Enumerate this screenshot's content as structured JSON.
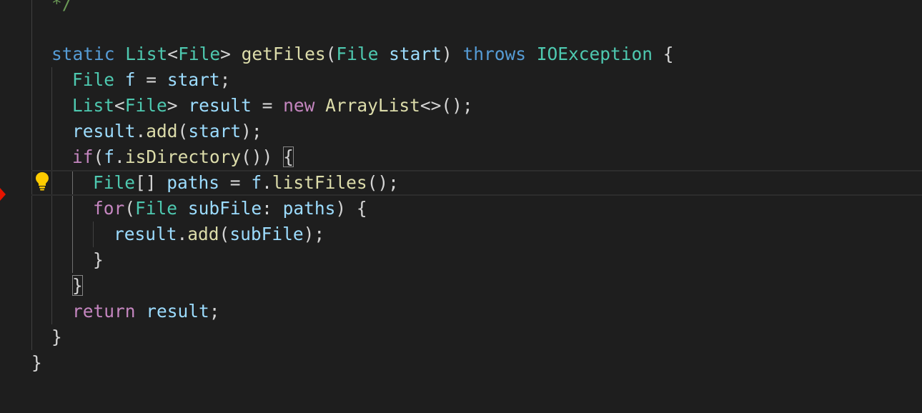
{
  "editor": {
    "language": "java",
    "lines": [
      {
        "id": "l0",
        "tokens": [
          {
            "t": "*/",
            "c": "cm"
          }
        ]
      },
      {
        "id": "l1",
        "tokens": []
      },
      {
        "id": "l2",
        "tokens": [
          {
            "t": "static",
            "c": "kw"
          },
          {
            "t": " "
          },
          {
            "t": "List",
            "c": "ty"
          },
          {
            "t": "<",
            "c": "pu"
          },
          {
            "t": "File",
            "c": "ty"
          },
          {
            "t": ">",
            "c": "pu"
          },
          {
            "t": " "
          },
          {
            "t": "getFiles",
            "c": "fn"
          },
          {
            "t": "(",
            "c": "pu"
          },
          {
            "t": "File",
            "c": "ty"
          },
          {
            "t": " "
          },
          {
            "t": "start",
            "c": "var"
          },
          {
            "t": ") ",
            "c": "pu"
          },
          {
            "t": "throws",
            "c": "kw"
          },
          {
            "t": " "
          },
          {
            "t": "IOException",
            "c": "ty"
          },
          {
            "t": " {",
            "c": "pu"
          }
        ]
      },
      {
        "id": "l3",
        "tokens": [
          {
            "t": "File",
            "c": "ty"
          },
          {
            "t": " "
          },
          {
            "t": "f",
            "c": "var"
          },
          {
            "t": " = ",
            "c": "pu"
          },
          {
            "t": "start",
            "c": "var"
          },
          {
            "t": ";",
            "c": "pu"
          }
        ]
      },
      {
        "id": "l4",
        "tokens": [
          {
            "t": "List",
            "c": "ty"
          },
          {
            "t": "<",
            "c": "pu"
          },
          {
            "t": "File",
            "c": "ty"
          },
          {
            "t": "> ",
            "c": "pu"
          },
          {
            "t": "result",
            "c": "var"
          },
          {
            "t": " = ",
            "c": "pu"
          },
          {
            "t": "new",
            "c": "ctl"
          },
          {
            "t": " "
          },
          {
            "t": "ArrayList",
            "c": "fn"
          },
          {
            "t": "<>();",
            "c": "pu"
          }
        ]
      },
      {
        "id": "l5",
        "tokens": [
          {
            "t": "result",
            "c": "var"
          },
          {
            "t": ".",
            "c": "pu"
          },
          {
            "t": "add",
            "c": "fn"
          },
          {
            "t": "(",
            "c": "pu"
          },
          {
            "t": "start",
            "c": "var"
          },
          {
            "t": ");",
            "c": "pu"
          }
        ]
      },
      {
        "id": "l6",
        "tokens": [
          {
            "t": "if",
            "c": "ctl"
          },
          {
            "t": "(",
            "c": "pu"
          },
          {
            "t": "f",
            "c": "var"
          },
          {
            "t": ".",
            "c": "pu"
          },
          {
            "t": "isDirectory",
            "c": "fn"
          },
          {
            "t": "()) ",
            "c": "pu"
          },
          {
            "t": "{",
            "c": "pu",
            "match": true
          }
        ]
      },
      {
        "id": "l7",
        "tokens": [
          {
            "t": "File",
            "c": "ty"
          },
          {
            "t": "[] ",
            "c": "pu"
          },
          {
            "t": "paths",
            "c": "var"
          },
          {
            "t": " = ",
            "c": "pu"
          },
          {
            "t": "f",
            "c": "var"
          },
          {
            "t": ".",
            "c": "pu"
          },
          {
            "t": "listFiles",
            "c": "fn"
          },
          {
            "t": "();",
            "c": "pu"
          }
        ]
      },
      {
        "id": "l8",
        "tokens": [
          {
            "t": "for",
            "c": "ctl"
          },
          {
            "t": "(",
            "c": "pu"
          },
          {
            "t": "File",
            "c": "ty"
          },
          {
            "t": " "
          },
          {
            "t": "subFile",
            "c": "var"
          },
          {
            "t": ": ",
            "c": "pu"
          },
          {
            "t": "paths",
            "c": "var"
          },
          {
            "t": ") {",
            "c": "pu"
          }
        ]
      },
      {
        "id": "l9",
        "tokens": [
          {
            "t": "result",
            "c": "var"
          },
          {
            "t": ".",
            "c": "pu"
          },
          {
            "t": "add",
            "c": "fn"
          },
          {
            "t": "(",
            "c": "pu"
          },
          {
            "t": "subFile",
            "c": "var"
          },
          {
            "t": ");",
            "c": "pu"
          }
        ]
      },
      {
        "id": "l10",
        "tokens": [
          {
            "t": "}",
            "c": "pu"
          }
        ]
      },
      {
        "id": "l11",
        "tokens": [
          {
            "t": "}",
            "c": "pu",
            "match": true
          }
        ]
      },
      {
        "id": "l12",
        "tokens": [
          {
            "t": "return",
            "c": "ctl"
          },
          {
            "t": " "
          },
          {
            "t": "result",
            "c": "var"
          },
          {
            "t": ";",
            "c": "pu"
          }
        ]
      },
      {
        "id": "l13",
        "tokens": [
          {
            "t": "}",
            "c": "pu"
          }
        ]
      },
      {
        "id": "l14",
        "tokens": [
          {
            "t": "}",
            "c": "pu"
          }
        ]
      }
    ]
  },
  "icons": {
    "lightbulb": "lightbulb-icon",
    "breakpoint": "breakpoint-marker-icon"
  },
  "colors": {
    "background": "#1e1e1e",
    "keyword": "#569cd6",
    "control": "#c586c0",
    "type": "#4ec9b0",
    "variable": "#9cdcfe",
    "function": "#dcdcaa",
    "comment": "#6a9955",
    "lightbulb": "#ffcc00",
    "breakpoint": "#e51400"
  }
}
